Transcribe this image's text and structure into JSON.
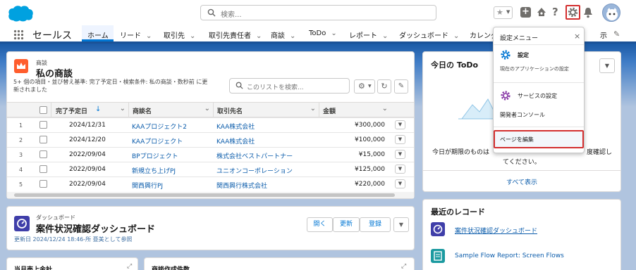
{
  "header": {
    "search_placeholder": "検索..."
  },
  "nav": {
    "app_name": "セールス",
    "tabs": [
      {
        "label": "ホーム"
      },
      {
        "label": "リード"
      },
      {
        "label": "取引先"
      },
      {
        "label": "取引先責任者"
      },
      {
        "label": "商談"
      },
      {
        "label": "ToDo"
      },
      {
        "label": "レポート"
      },
      {
        "label": "ダッシュボード"
      },
      {
        "label": "カレンダ"
      }
    ],
    "overflow_label": "示"
  },
  "opps": {
    "object_label": "商談",
    "title": "私の商談",
    "subtitle_line1": "5+ 個の項目・並び替え基準: 完了予定日・検索条件: 私の商談・数秒前 に更",
    "subtitle_line2": "新されました",
    "search_placeholder": "このリストを検索...",
    "columns": [
      "完了予定日",
      "商談名",
      "取引先名",
      "金額"
    ],
    "sort_icon": "↓",
    "rows": [
      {
        "num": "1",
        "date": "2024/12/31",
        "name": "KAAプロジェクト2",
        "account": "KAA株式会社",
        "amount": "¥300,000"
      },
      {
        "num": "2",
        "date": "2024/12/20",
        "name": "KAAプロジェクト",
        "account": "KAA株式会社",
        "amount": "¥100,000"
      },
      {
        "num": "3",
        "date": "2022/09/04",
        "name": "BPプロジェクト",
        "account": "株式会社ベストパートナー",
        "amount": "¥15,000"
      },
      {
        "num": "4",
        "date": "2022/09/04",
        "name": "新規立ち上げPJ",
        "account": "ユニオンコーポレーション",
        "amount": "¥125,000"
      },
      {
        "num": "5",
        "date": "2022/09/04",
        "name": "関西興行PJ",
        "account": "関西興行株式会社",
        "amount": "¥220,000"
      }
    ]
  },
  "dashboard": {
    "object_label": "ダッシュボード",
    "title": "案件状況確認ダッシュボード",
    "updated": "更新日 2024/12/24 18:46-所 亜美として参照",
    "buttons": [
      "開く",
      "更新",
      "登録"
    ]
  },
  "bottom": {
    "left_title": "当月売上金計",
    "right_title": "商談作成件数"
  },
  "todo": {
    "title": "今日の ToDo",
    "msg_line1_a": "今日が期限のものは",
    "msg_line1_b": "度確認し",
    "msg_line2": "てください。",
    "show_all": "すべて表示"
  },
  "recent": {
    "title": "最近のレコード",
    "items": [
      {
        "label": "案件状況確認ダッシュボード",
        "color": "#3f3ea9"
      },
      {
        "label": "Sample Flow Report: Screen Flows",
        "color": "#1b9aa0"
      }
    ]
  },
  "settings_menu": {
    "title": "設定メニュー",
    "close": "×",
    "setup_label": "設定",
    "setup_desc": "現在のアプリケーションの設定",
    "service_label": "サービスの設定",
    "dev_console": "開発者コンソール",
    "edit_page": "ページを編集"
  },
  "colors": {
    "brand": "#0176d3",
    "highlight": "#d32f2f",
    "opp_icon": "#ff5d2d",
    "dash_icon": "#3f3ea9"
  }
}
